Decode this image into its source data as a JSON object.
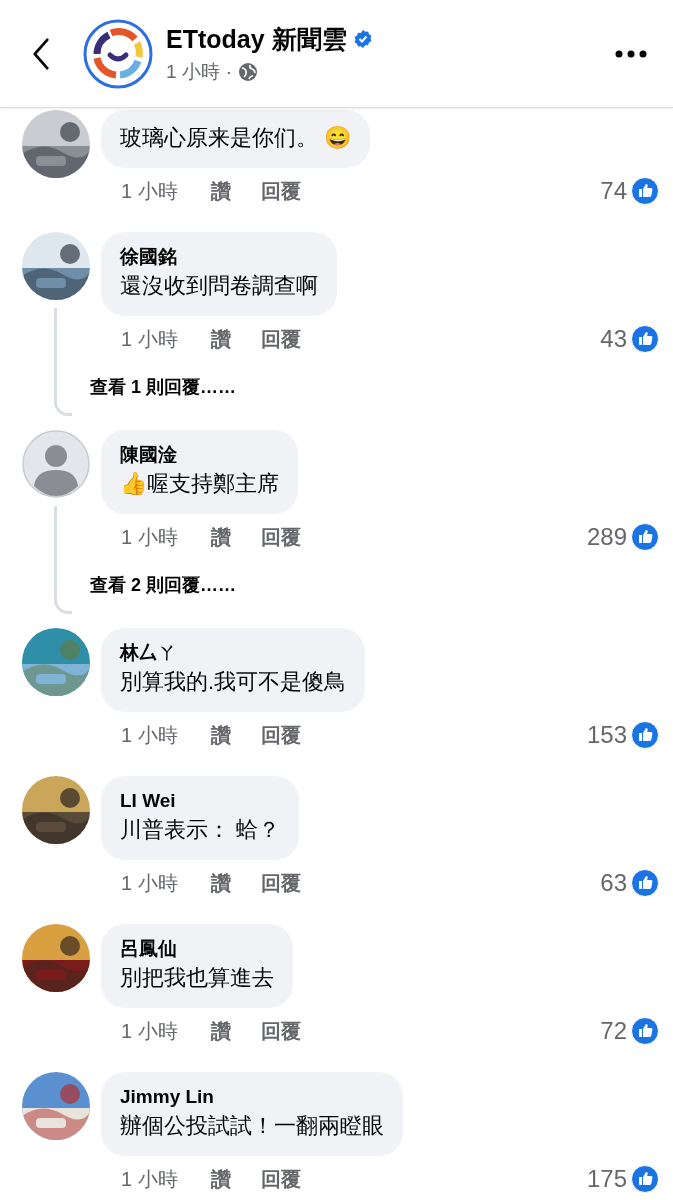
{
  "header": {
    "page_name": "ETtoday 新聞雲",
    "verified": true,
    "time": "1 小時",
    "separator": "·"
  },
  "comments": [
    {
      "text": "玻璃心原来是你们。 😄",
      "time": "1 小時",
      "like": "讚",
      "reply": "回覆",
      "count": "74"
    },
    {
      "name": "徐國銘",
      "text": "還沒收到問卷調查啊",
      "time": "1 小時",
      "like": "讚",
      "reply": "回覆",
      "count": "43",
      "replies_link": "查看 1 則回覆……"
    },
    {
      "avatar": {
        "kind": "silhouette"
      },
      "name": "陳國淦",
      "text": "👍喔支持鄭主席",
      "time": "1 小時",
      "like": "讚",
      "reply": "回覆",
      "count": "289",
      "replies_link": "查看 2 則回覆……"
    },
    {
      "name": "林厶ㄚ",
      "text": "別算我的.我可不是傻鳥",
      "time": "1 小時",
      "like": "讚",
      "reply": "回覆",
      "count": "153"
    },
    {
      "name": "LI Wei",
      "text": "川普表示： 蛤？",
      "time": "1 小時",
      "like": "讚",
      "reply": "回覆",
      "count": "63"
    },
    {
      "name": "呂鳳仙",
      "text": "別把我也算進去",
      "time": "1 小時",
      "like": "讚",
      "reply": "回覆",
      "count": "72"
    },
    {
      "name": "Jimmy Lin",
      "text": "辦個公投試試！一翻兩瞪眼",
      "time": "1 小時",
      "like": "讚",
      "reply": "回覆",
      "count": "175"
    }
  ]
}
